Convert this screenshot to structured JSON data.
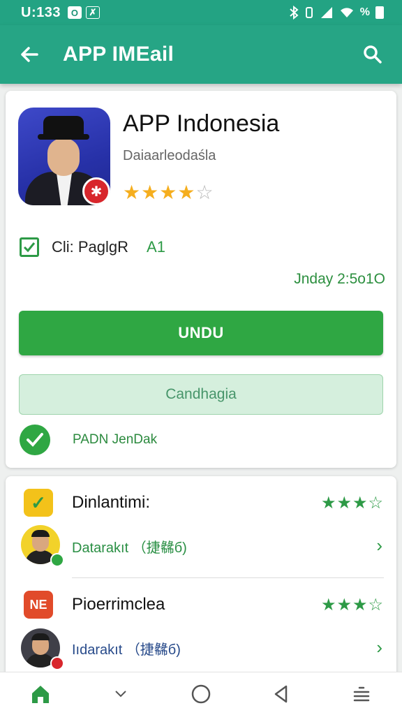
{
  "status_bar": {
    "time": "U:133",
    "notifications": [
      "O",
      "✗"
    ],
    "right_text": "%"
  },
  "app_bar": {
    "title": "APP IMEail"
  },
  "app": {
    "name": "APP Indonesia",
    "subtitle": "Daiaarleodaśla",
    "rating": 4,
    "rating_max": 5,
    "checkbox_label": "Cli: PaglgR",
    "checkbox_badge": "A1",
    "date": "Jnday 2:5o1O",
    "primary_button": "UNDU",
    "secondary_button": "Candhagia",
    "status_label": "PADN JenDak"
  },
  "list": [
    {
      "title": "Dinlantimi:",
      "subtitle": "Datarakıt （捷㣈б)",
      "icon_text": "✓",
      "icon_bg": "#f3c21a",
      "stars": "★★★☆"
    },
    {
      "title": "Pioerrimclea",
      "subtitle": "Iıdarakıt （捷㣈б)",
      "icon_text": "NE",
      "icon_bg": "#e14b2a",
      "stars": "★★★☆"
    }
  ],
  "colors": {
    "accent": "#26a585",
    "primary_green": "#2fa743",
    "star": "#f5ae1e"
  }
}
